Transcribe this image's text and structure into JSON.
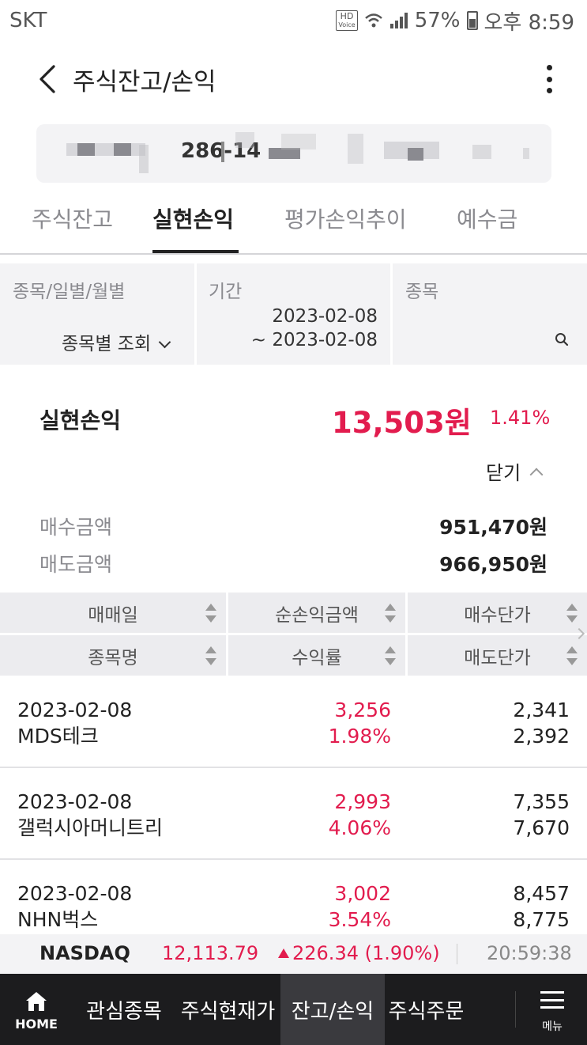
{
  "status": {
    "carrier": "SKT",
    "hd_label": "HD",
    "hd_sub": "Voice",
    "battery": "57%",
    "time": "오후 8:59"
  },
  "header": {
    "title": "주식잔고/손익"
  },
  "account": {
    "number_visible": "286-14"
  },
  "tabs": [
    {
      "label": "주식잔고"
    },
    {
      "label": "실현손익"
    },
    {
      "label": "평가손익추이"
    },
    {
      "label": "예수금"
    }
  ],
  "filter": {
    "type_label": "종목/일별/월별",
    "type_value": "종목별 조회",
    "period_label": "기간",
    "period_from": "2023-02-08",
    "period_to": "~ 2023-02-08",
    "stock_label": "종목"
  },
  "summary": {
    "label": "실현손익",
    "value": "13,503원",
    "rate": "1.41%",
    "toggle_label": "닫기",
    "buy_label": "매수금액",
    "buy_value": "951,470원",
    "sell_label": "매도금액",
    "sell_value": "966,950원"
  },
  "table": {
    "headers_row1": [
      "매매일",
      "순손익금액",
      "매수단가"
    ],
    "headers_row2": [
      "종목명",
      "수익률",
      "매도단가"
    ],
    "rows": [
      {
        "date": "2023-02-08",
        "name": "MDS테크",
        "profit": "3,256",
        "rate": "1.98%",
        "buy_price": "2,341",
        "sell_price": "2,392"
      },
      {
        "date": "2023-02-08",
        "name": "갤럭시아머니트리",
        "profit": "2,993",
        "rate": "4.06%",
        "buy_price": "7,355",
        "sell_price": "7,670"
      },
      {
        "date": "2023-02-08",
        "name": "NHN벅스",
        "profit": "3,002",
        "rate": "3.54%",
        "buy_price": "8,457",
        "sell_price": "8,775"
      }
    ]
  },
  "ticker": {
    "name": "NASDAQ",
    "value": "12,113.79",
    "change": "226.34 (1.90%)",
    "time": "20:59:38"
  },
  "bottom_nav": {
    "home": "HOME",
    "items": [
      "관심종목",
      "주식현재가",
      "잔고/손익",
      "주식주문"
    ],
    "menu": "메뉴"
  },
  "colors": {
    "accent_red": "#e21c4e",
    "nav_bg": "#1c1c1e",
    "panel_bg": "#f3f3f5"
  },
  "icons": [
    "back-arrow-icon",
    "kebab-menu-icon",
    "search-icon",
    "sort-icon",
    "home-icon",
    "hamburger-menu-icon"
  ]
}
